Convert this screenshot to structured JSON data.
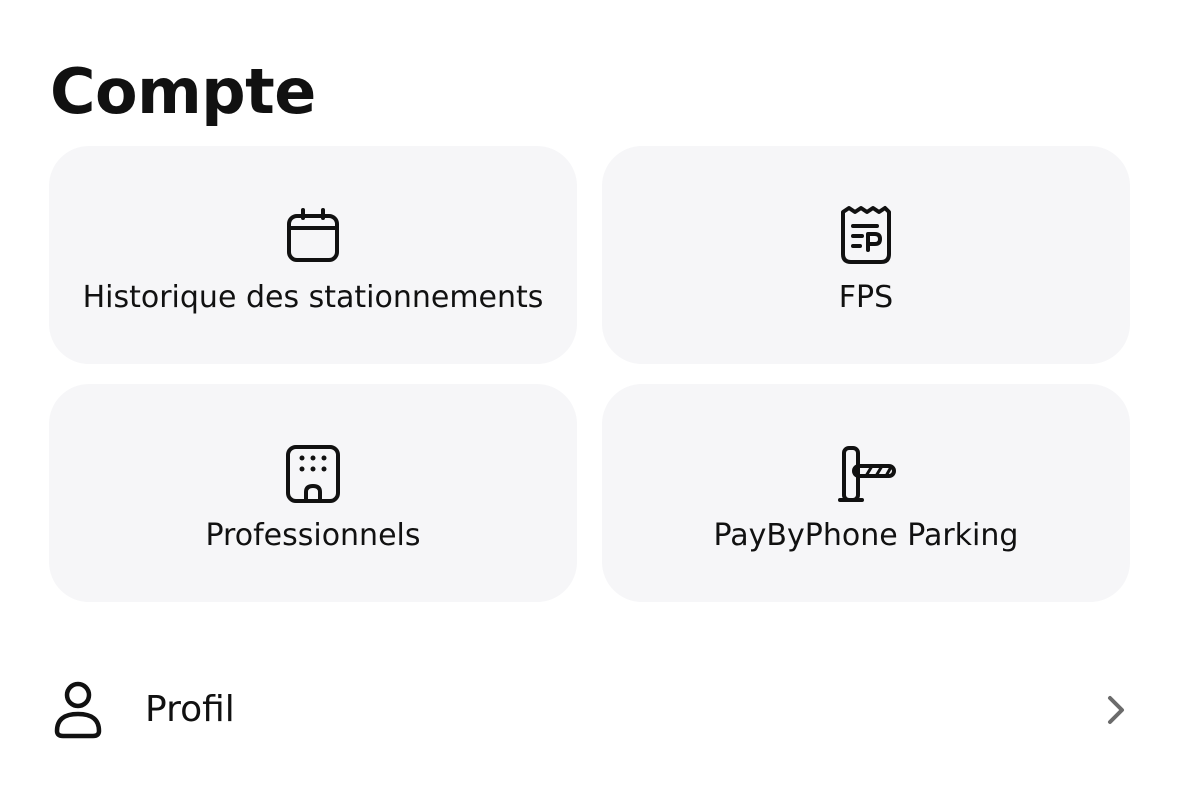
{
  "section": {
    "title": "Compte"
  },
  "tiles": [
    {
      "label": "Historique des stationnements",
      "icon": "calendar-icon"
    },
    {
      "label": "FPS",
      "icon": "parking-ticket-icon"
    },
    {
      "label": "Professionnels",
      "icon": "building-icon"
    },
    {
      "label": "PayByPhone Parking",
      "icon": "parking-barrier-icon"
    }
  ],
  "rows": [
    {
      "label": "Profil",
      "icon": "user-icon",
      "trailing_icon": "chevron-right-icon"
    }
  ],
  "colors": {
    "tile_background": "#f6f6f8",
    "text": "#111111",
    "chevron": "#6b6b6b"
  }
}
